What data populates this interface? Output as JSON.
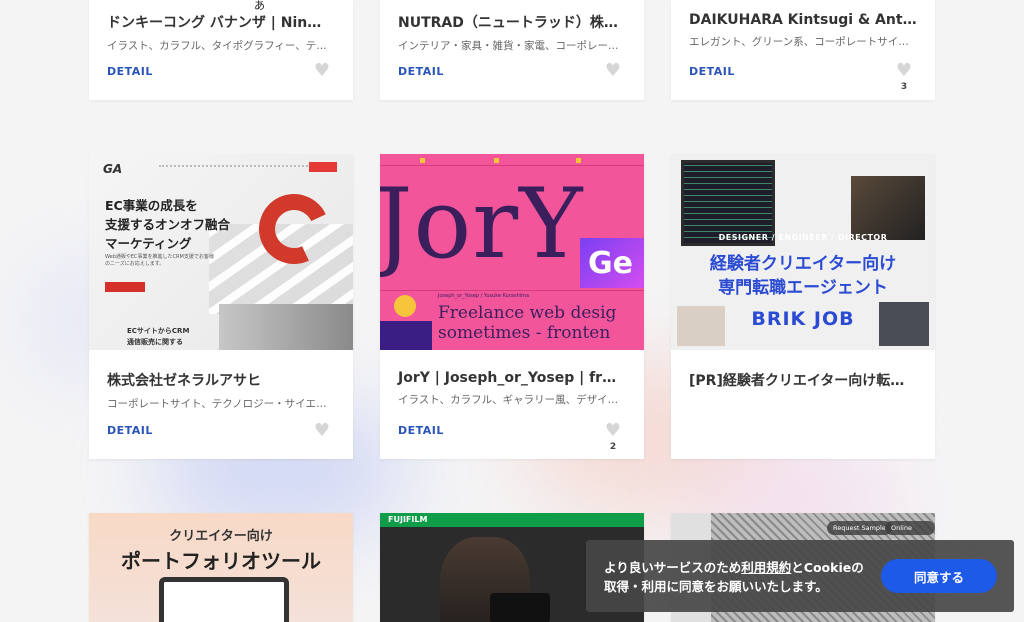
{
  "cards": [
    {
      "title": "ドンキーコング バナンザ | Nin…",
      "tags": "イラスト、カラフル、タイポグラフィー、テレ…",
      "detail": "DETAIL",
      "likes": ""
    },
    {
      "title": "NUTRAD（ニュートラッド）株…",
      "tags": "インテリア・家具・雑貨・家電、コーポレート…",
      "detail": "DETAIL",
      "likes": ""
    },
    {
      "title": "DAIKUHARA Kintsugi & Anti…",
      "tags": "エレガント、グリーン系、コーポレートサイト…",
      "detail": "DETAIL",
      "likes": "3"
    },
    {
      "title": "株式会社ゼネラルアサヒ",
      "tags": "コーポレートサイト、テクノロジー・サイエン…",
      "detail": "DETAIL",
      "likes": ""
    },
    {
      "title": "JorY | Joseph_or_Yosep | fr…",
      "tags": "イラスト、カラフル、ギャラリー風、デザイン…",
      "detail": "DETAIL",
      "likes": "2"
    },
    {
      "title": "[PR]経験者クリエイター向け転…",
      "tags": "",
      "detail": "",
      "likes": ""
    }
  ],
  "thumbs": {
    "general": {
      "logo": "GA",
      "headline1": "EC事業の成長を",
      "headline2": "支援するオンオフ融合",
      "headline3": "マーケティング",
      "sub": "Web通販やEC事業を推進したCRM支援でお客様のニーズにお応えします。",
      "bottom1": "ECサイトからCRM",
      "bottom2": "通信販売に関する"
    },
    "jory": {
      "big": "JorY",
      "ge": "Ge",
      "small": "Joseph_or_Yosep / Yusuke Kurashima",
      "line1": "Freelance web desig",
      "line2": "sometimes - fronten"
    },
    "brik": {
      "band": "DESIGNER / ENGINEER / DIRECTOR",
      "jp1": "経験者クリエイター向け",
      "jp2": "専門転職エージェント",
      "logo": "BRIK JOB"
    },
    "portfolio": {
      "line1": "クリエイター向け",
      "line2": "ポートフォリオツール"
    },
    "film": {
      "brand": "FUJIFILM"
    },
    "grey": {
      "pill1": "Request Sample",
      "pill2": "Online Shop"
    }
  },
  "ime_char": "あ",
  "cookie": {
    "text_before": "より良いサービスのため",
    "link": "利用規約",
    "text_after": "とCookieの",
    "line2": "取得・利用に同意をお願いいたします。",
    "button": "同意する"
  },
  "colors": {
    "accent": "#1e5ae8",
    "detail": "#2a55b8",
    "jory_pink": "#f3559a",
    "brik_blue": "#2b4bd3"
  }
}
